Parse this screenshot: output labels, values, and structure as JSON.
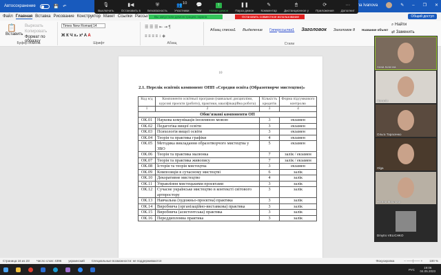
{
  "titlebar": {
    "autosave": "Автосохранение",
    "user": "Anna Ivanova"
  },
  "zoom": {
    "buttons": [
      "Выключить",
      "Остановить в",
      "Безопасность",
      "Участники",
      "Чат",
      "Новая демон",
      "Пауза демон",
      "Комментар",
      "Дистанционное у",
      "Приложения",
      "Дополнит"
    ],
    "participants_count": "10",
    "banner_green": "Вы запустили демонстрацию экрана",
    "banner_red": "Остановить совместное использование"
  },
  "menu": [
    "Файл",
    "Главная",
    "Вставка",
    "Рисование",
    "Конструктор",
    "Макет",
    "Ссылки",
    "Рассыл"
  ],
  "share_label": "Общий доступ",
  "ribbon": {
    "paste": "Вставить",
    "cut": "Вырезать",
    "copy": "Копировать",
    "format_painter": "Формат по образцу",
    "clipboard": "Буфер обмена",
    "font_name": "Times New Roman",
    "font_size": "14",
    "font_group": "Шрифт",
    "para_group": "Абзац",
    "styles_group": "Стили",
    "styles": [
      "Абзац списка1",
      "Выделение",
      "Гиперссылка1",
      "Заголовок",
      "Заголовок 8",
      "Название объект"
    ],
    "find": "Найти",
    "replace": "Заменить"
  },
  "document": {
    "page_number": "10",
    "title": "2.1. Перелік освітніх компонент ОПП «Середня освіта (Образотворче мистецтво)»",
    "headers": [
      "Код н/д",
      "Компоненти освітньої програми (навчальні дисципліни, курсові проєкти (роботи), практики, кваліфікаційна робота)",
      "Кількість кредитів",
      "Форма підсумкового контролю"
    ],
    "col_numbers": [
      "1",
      "2",
      "3",
      "4"
    ],
    "section": "Обов'язкові компоненти ОП",
    "rows": [
      [
        "ОК.01",
        "Наукова комунікація іноземною мовою",
        "3",
        "екзамен"
      ],
      [
        "ОК.02",
        "Педагогіка вищої освіти",
        "3",
        "екзамен"
      ],
      [
        "ОК.03",
        "Психологія вищої освіти",
        "3",
        "екзамен"
      ],
      [
        "ОК.04",
        "Теорія та практика графіки",
        "4",
        "екзамен"
      ],
      [
        "ОК.05",
        "Методика викладання образотворчого мистецтва у ЗВО",
        "5",
        "екзамен"
      ],
      [
        "ОК.06",
        "Теорія та практика малюнка",
        "7",
        "залік / екзамен"
      ],
      [
        "ОК.07",
        "Теорія та практика живопису",
        "7",
        "залік / екзамен"
      ],
      [
        "ОК.08",
        "Історія та теорія мистецтва",
        "3",
        "екзамен"
      ],
      [
        "ОК.09",
        "Композиція в сучасному мистецтві",
        "6",
        "залік"
      ],
      [
        "ОК.10",
        "Декоративне мистецтво",
        "4",
        "залік"
      ],
      [
        "ОК.11",
        "Управління мистецькими проєктами",
        "3",
        "залік"
      ],
      [
        "ОК.12",
        "Сучасне українське мистецтво в контексті світового артпростору",
        "3",
        "залік"
      ],
      [
        "ОК.13",
        "Навчальна (художньо-проєктна) практика",
        "3",
        "залік"
      ],
      [
        "ОК.14",
        "Виробнича (організаційно-виставкова) практика",
        "3",
        "залік"
      ],
      [
        "ОК.15",
        "Виробнича (асистентська) практика",
        "3",
        "залік"
      ],
      [
        "ОК.16",
        "Переддипломна практика",
        "3",
        "залік"
      ]
    ]
  },
  "participants": [
    "Анна Ivanova",
    "Наталія",
    "Ольга Тарасенко",
    "Olga",
    "Тетяна Маслова",
    "Dmytro VELICHKO"
  ],
  "status": {
    "page": "Страница 16 из 23",
    "words": "Число слов: 4396",
    "lang": "украинский",
    "accessibility": "Специальные возможности: не поддерживаются",
    "focus": "Фокусировка",
    "zoom": "100 %"
  },
  "taskbar": {
    "lang": "РУС",
    "time": "19:06",
    "date": "04.05.2023"
  }
}
